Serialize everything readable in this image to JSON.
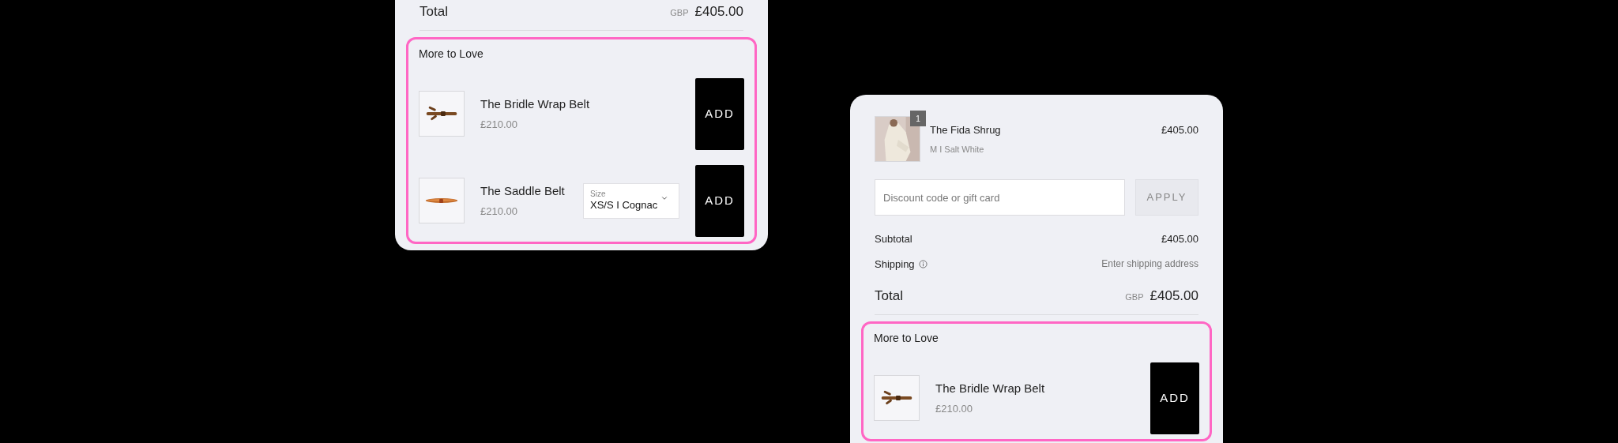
{
  "panels": [
    {
      "total": {
        "label": "Total",
        "currency": "GBP",
        "amount": "£405.00"
      },
      "more_to_love": {
        "title": "More to Love",
        "products": [
          {
            "name": "The Bridle Wrap Belt",
            "price": "£210.00",
            "kind": "wrap",
            "button": "ADD"
          },
          {
            "name": "The Saddle Belt",
            "price": "£210.00",
            "kind": "saddle",
            "size": {
              "label": "Size",
              "value": "XS/S I Cognac"
            },
            "button": "ADD"
          }
        ]
      }
    },
    {
      "cart_item": {
        "name": "The Fida Shrug",
        "variant": "M I Salt White",
        "price": "£405.00",
        "quantity": "1"
      },
      "discount": {
        "placeholder": "Discount code or gift card",
        "button": "APPLY"
      },
      "subtotal": {
        "label": "Subtotal",
        "amount": "£405.00"
      },
      "shipping": {
        "label": "Shipping",
        "value": "Enter shipping address"
      },
      "total": {
        "label": "Total",
        "currency": "GBP",
        "amount": "£405.00"
      },
      "more_to_love": {
        "title": "More to Love",
        "products": [
          {
            "name": "The Bridle Wrap Belt",
            "price": "£210.00",
            "kind": "wrap",
            "button": "ADD"
          }
        ]
      }
    }
  ]
}
